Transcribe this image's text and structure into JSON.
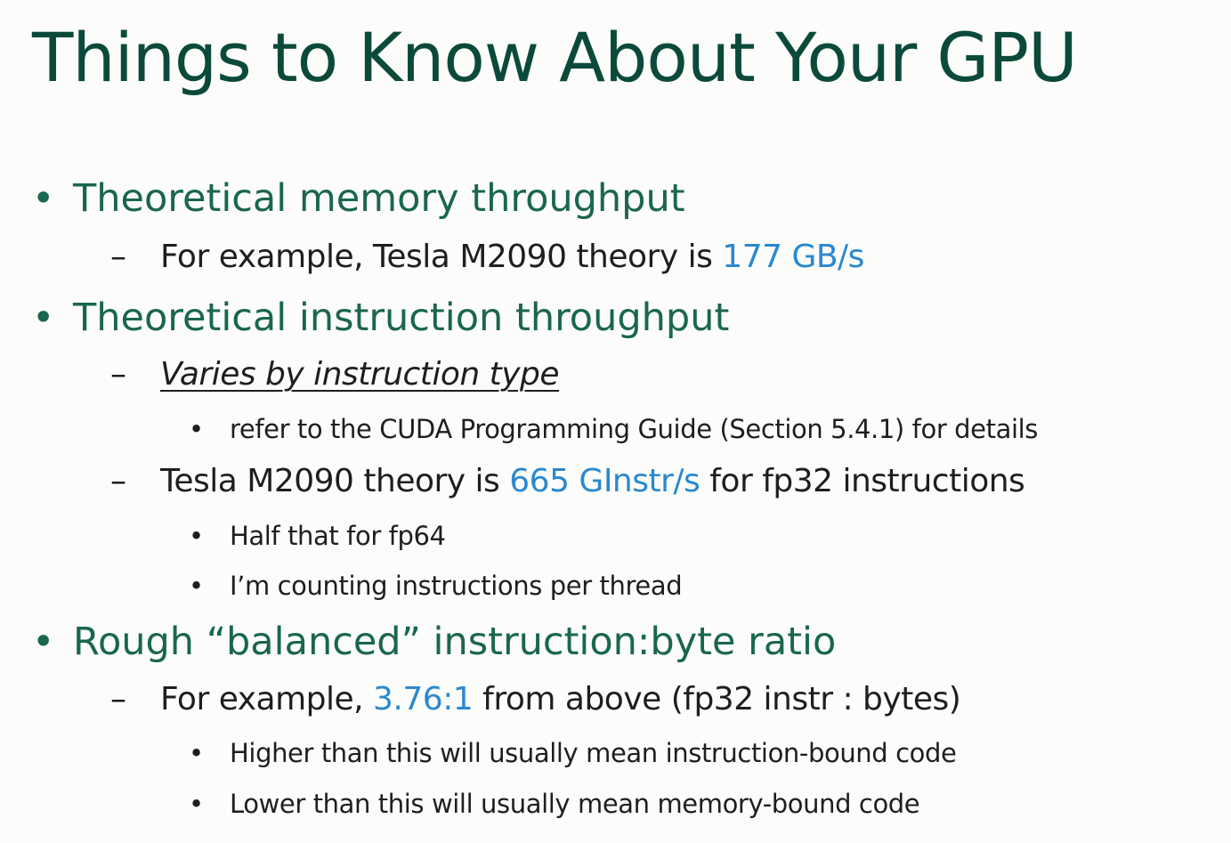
{
  "slide": {
    "title": "Things to Know About Your GPU",
    "colors": {
      "title": "#0b4a3a",
      "level1": "#1a6650",
      "body": "#1e1e1e",
      "highlight": "#2a88cf"
    },
    "items": [
      {
        "level": 1,
        "text": "Theoretical memory throughput"
      },
      {
        "level": 2,
        "pre": "For example, Tesla M2090 theory is ",
        "highlight": "177 GB/s",
        "post": ""
      },
      {
        "level": 1,
        "text": "Theoretical instruction throughput"
      },
      {
        "level": 2,
        "text": "Varies by instruction type"
      },
      {
        "level": 3,
        "text": "refer to the CUDA Programming Guide (Section 5.4.1) for details"
      },
      {
        "level": 2,
        "pre": "Tesla M2090 theory is ",
        "highlight": "665 GInstr/s",
        "post": " for fp32 instructions"
      },
      {
        "level": 3,
        "text": "Half that for fp64"
      },
      {
        "level": 3,
        "text": "I’m counting instructions per thread"
      },
      {
        "level": 1,
        "text": "Rough “balanced” instruction:byte ratio"
      },
      {
        "level": 2,
        "pre": "For example, ",
        "highlight": "3.76:1",
        "post": " from above (fp32 instr : bytes)"
      },
      {
        "level": 3,
        "text": "Higher than this will usually mean instruction-bound code"
      },
      {
        "level": 3,
        "text": "Lower than this will usually mean memory-bound code"
      }
    ],
    "bullets": {
      "level1": "•",
      "level2": "–",
      "level3": "•"
    }
  }
}
